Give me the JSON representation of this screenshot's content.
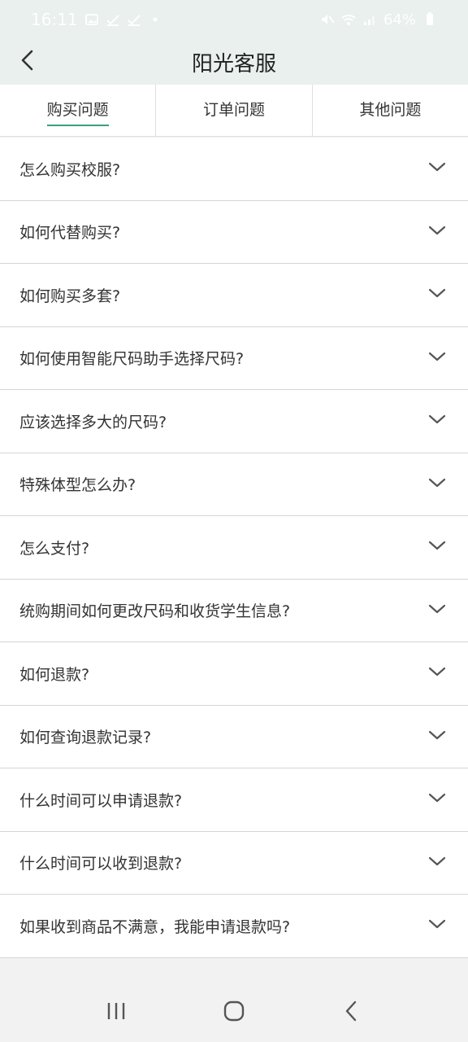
{
  "status_bar": {
    "time": "16:11",
    "battery": "64%"
  },
  "header": {
    "title": "阳光客服",
    "back_icon": "chevron-left-icon"
  },
  "tabs": [
    {
      "label": "购买问题",
      "active": true
    },
    {
      "label": "订单问题",
      "active": false
    },
    {
      "label": "其他问题",
      "active": false
    }
  ],
  "faq": [
    {
      "question": "怎么购买校服?"
    },
    {
      "question": "如何代替购买?"
    },
    {
      "question": "如何购买多套?"
    },
    {
      "question": "如何使用智能尺码助手选择尺码?"
    },
    {
      "question": "应该选择多大的尺码?"
    },
    {
      "question": "特殊体型怎么办?"
    },
    {
      "question": "怎么支付?"
    },
    {
      "question": "统购期间如何更改尺码和收货学生信息?"
    },
    {
      "question": "如何退款?"
    },
    {
      "question": "如何查询退款记录?"
    },
    {
      "question": "什么时间可以申请退款?"
    },
    {
      "question": "什么时间可以收到退款?"
    },
    {
      "question": "如果收到商品不满意，我能申请退款吗?"
    }
  ],
  "colors": {
    "header_bg": "#e9f0ee",
    "accent": "#3a9e7f"
  }
}
